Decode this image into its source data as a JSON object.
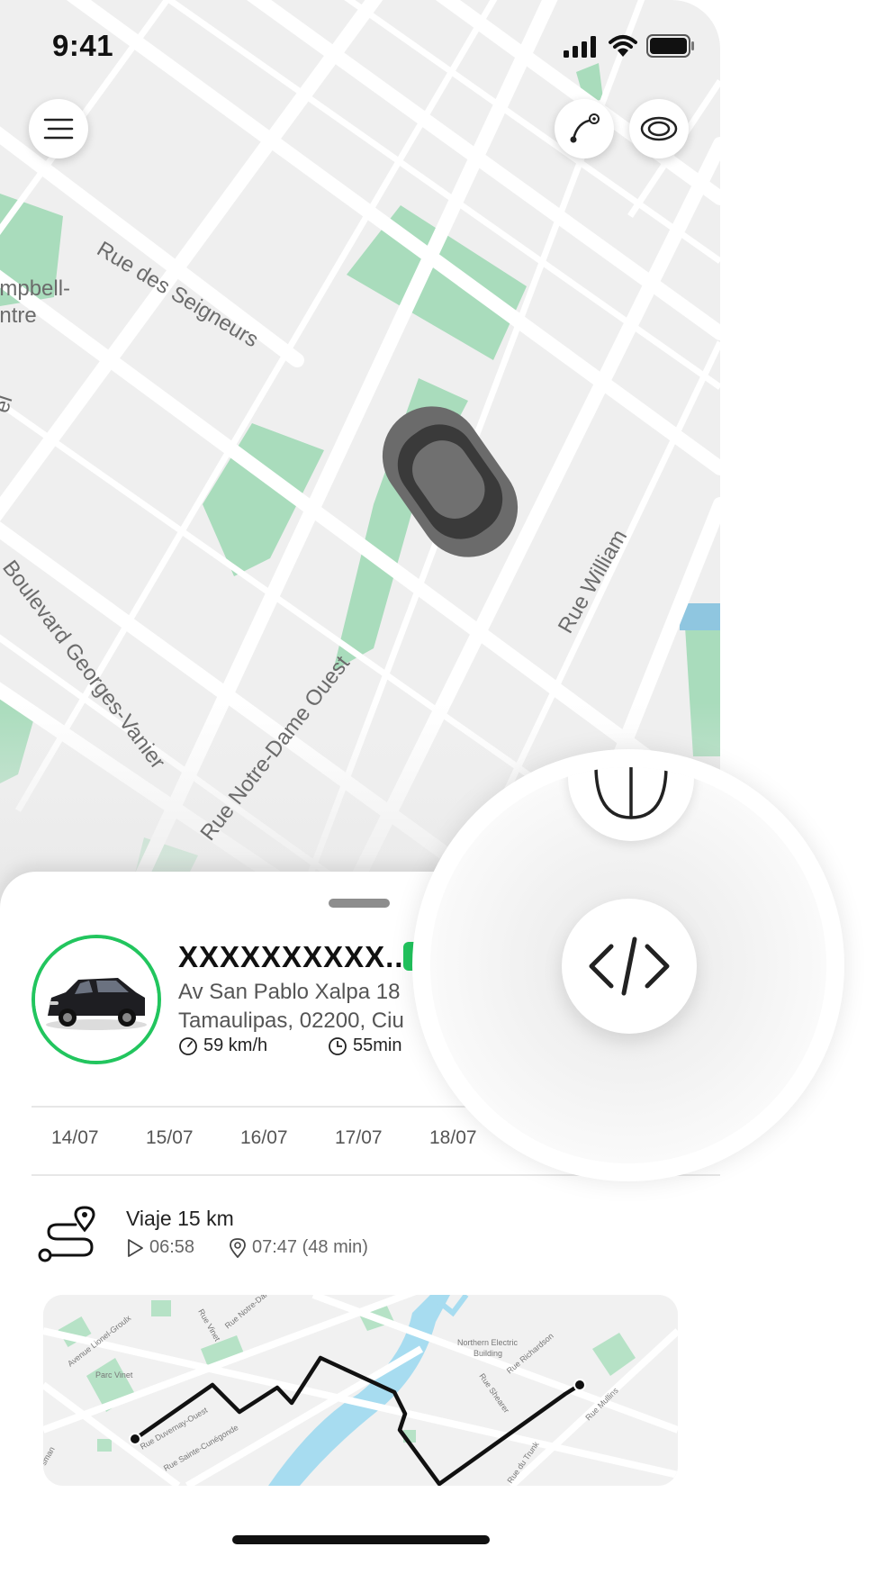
{
  "status_bar": {
    "time": "9:41"
  },
  "map": {
    "street_labels": [
      "Rue des Seigneurs",
      "Rue Notre-Dame Ouest",
      "Rue William",
      "Boulevard Georges-Vanier",
      "ampbell-",
      "entre",
      "el"
    ],
    "buttons": {
      "menu_icon": "menu-icon",
      "route_icon": "route-icon",
      "view_icon": "eye-icon"
    }
  },
  "vehicle": {
    "name": "XXXXXXXXXX...",
    "address_line1": "Av San Pablo Xalpa 18",
    "address_line2": "Tamaulipas, 02200, Ciu",
    "speed": "59 km/h",
    "duration": "55min",
    "status_color": "#22c55e"
  },
  "dates": [
    "14/07",
    "15/07",
    "16/07",
    "17/07",
    "18/07"
  ],
  "trip": {
    "title": "Viaje 15 km",
    "start_time": "06:58",
    "end_time": "07:47 (48 min)"
  },
  "minimap": {
    "labels": [
      "Avenue Lionel-Groulx",
      "Parc Vinet",
      "Rue Vinet",
      "Rue Notre-Dame",
      "Northern Electric",
      "Building",
      "Rue Richardson",
      "Rue Shearer",
      "Rue Duvernay-Ouest",
      "Rue Sainte-Cunégonde",
      "Rue Mullins",
      "Rue du Trunk",
      "sman",
      "Rue Vinet"
    ]
  },
  "magnifier": {
    "icon": "code-icon"
  }
}
